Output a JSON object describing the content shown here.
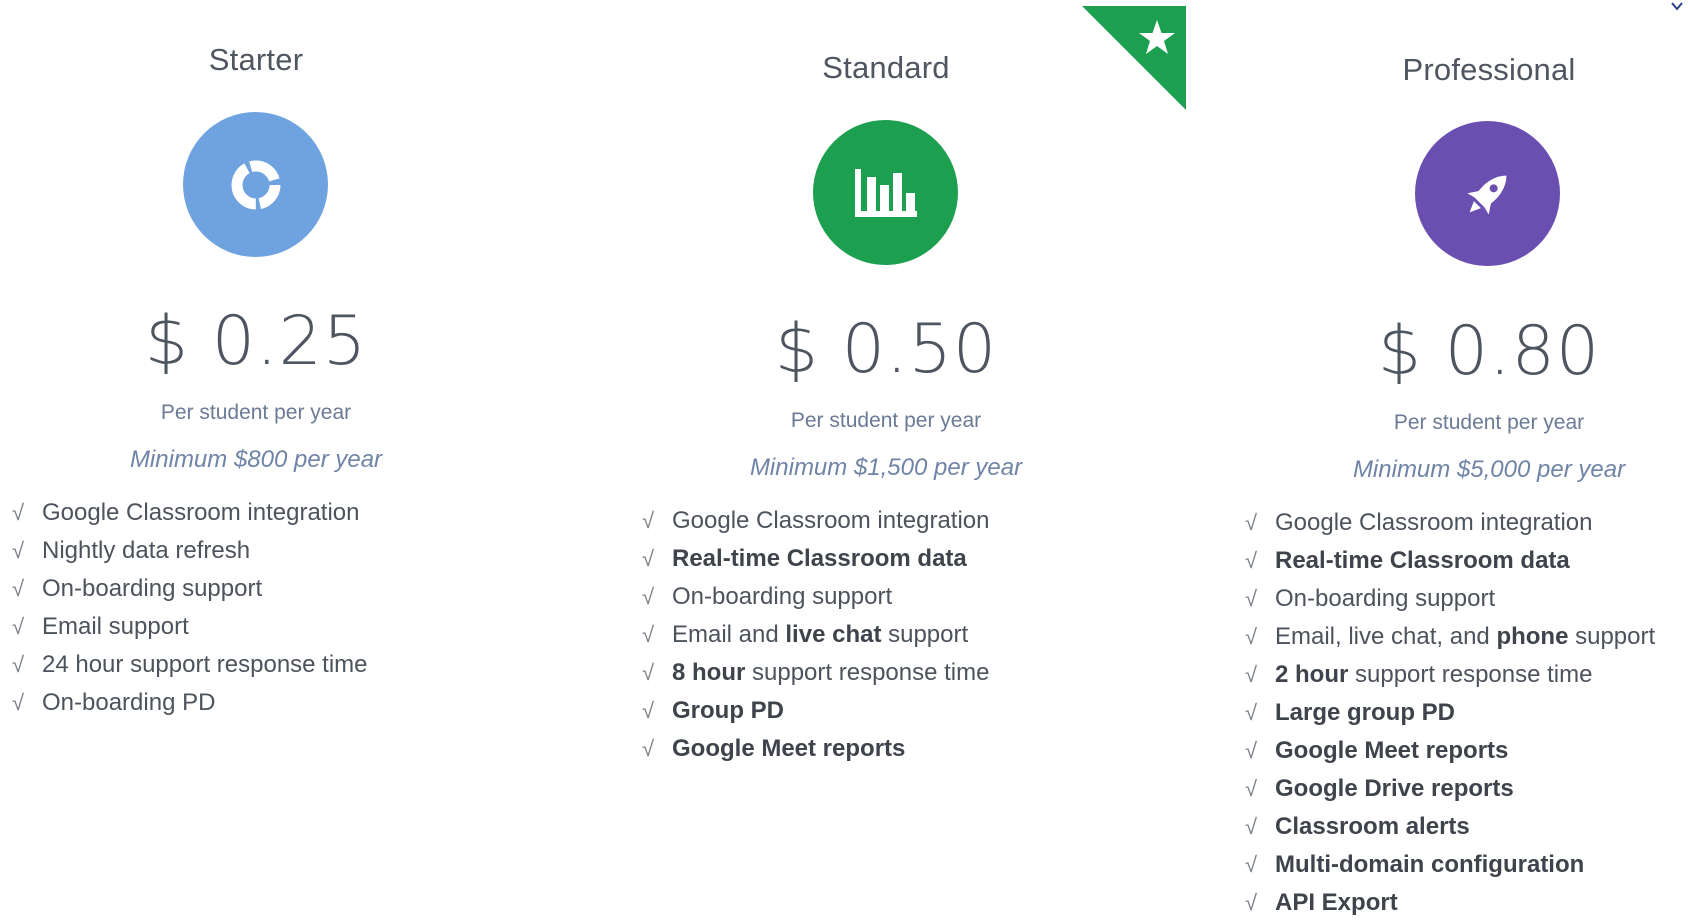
{
  "colors": {
    "starter": "#6fa3e0",
    "standard": "#1ca04f",
    "professional": "#6a4fb0",
    "ribbon": "#1ca04f"
  },
  "ribbon": {
    "icon": "star-icon"
  },
  "plans": [
    {
      "title": "Starter",
      "icon": "donut-chart-icon",
      "price": "$ 0.25",
      "per": "Per student per year",
      "minimum": "Minimum $800 per year",
      "features": [
        [
          {
            "t": "Google Classroom integration",
            "b": false
          }
        ],
        [
          {
            "t": "Nightly data refresh",
            "b": false
          }
        ],
        [
          {
            "t": "On-boarding support",
            "b": false
          }
        ],
        [
          {
            "t": "Email support",
            "b": false
          }
        ],
        [
          {
            "t": "24 hour support response time",
            "b": false
          }
        ],
        [
          {
            "t": "On-boarding PD",
            "b": false
          }
        ]
      ]
    },
    {
      "title": "Standard",
      "icon": "bar-chart-icon",
      "price": "$ 0.50",
      "per": "Per student per year",
      "minimum": "Minimum $1,500 per year",
      "features": [
        [
          {
            "t": "Google Classroom integration",
            "b": false
          }
        ],
        [
          {
            "t": "Real-time Classroom data",
            "b": true
          }
        ],
        [
          {
            "t": "On-boarding support",
            "b": false
          }
        ],
        [
          {
            "t": "Email and ",
            "b": false
          },
          {
            "t": "live chat",
            "b": true
          },
          {
            "t": " support",
            "b": false
          }
        ],
        [
          {
            "t": "8 hour",
            "b": true
          },
          {
            "t": " support response time",
            "b": false
          }
        ],
        [
          {
            "t": "Group PD",
            "b": true
          }
        ],
        [
          {
            "t": "Google Meet reports",
            "b": true
          }
        ]
      ]
    },
    {
      "title": "Professional",
      "icon": "rocket-icon",
      "price": "$ 0.80",
      "per": "Per student per year",
      "minimum": "Minimum $5,000 per year",
      "features": [
        [
          {
            "t": "Google Classroom integration",
            "b": false
          }
        ],
        [
          {
            "t": "Real-time Classroom data",
            "b": true
          }
        ],
        [
          {
            "t": "On-boarding support",
            "b": false
          }
        ],
        [
          {
            "t": "Email, live chat, and ",
            "b": false
          },
          {
            "t": "phone",
            "b": true
          },
          {
            "t": " support",
            "b": false
          }
        ],
        [
          {
            "t": "2 hour",
            "b": true
          },
          {
            "t": " support response time",
            "b": false
          }
        ],
        [
          {
            "t": "Large group PD",
            "b": true
          }
        ],
        [
          {
            "t": "Google Meet reports",
            "b": true
          }
        ],
        [
          {
            "t": "Google Drive reports",
            "b": true
          }
        ],
        [
          {
            "t": "Classroom alerts",
            "b": true
          }
        ],
        [
          {
            "t": "Multi-domain configuration",
            "b": true
          }
        ],
        [
          {
            "t": "API Export",
            "b": true
          }
        ]
      ]
    }
  ]
}
